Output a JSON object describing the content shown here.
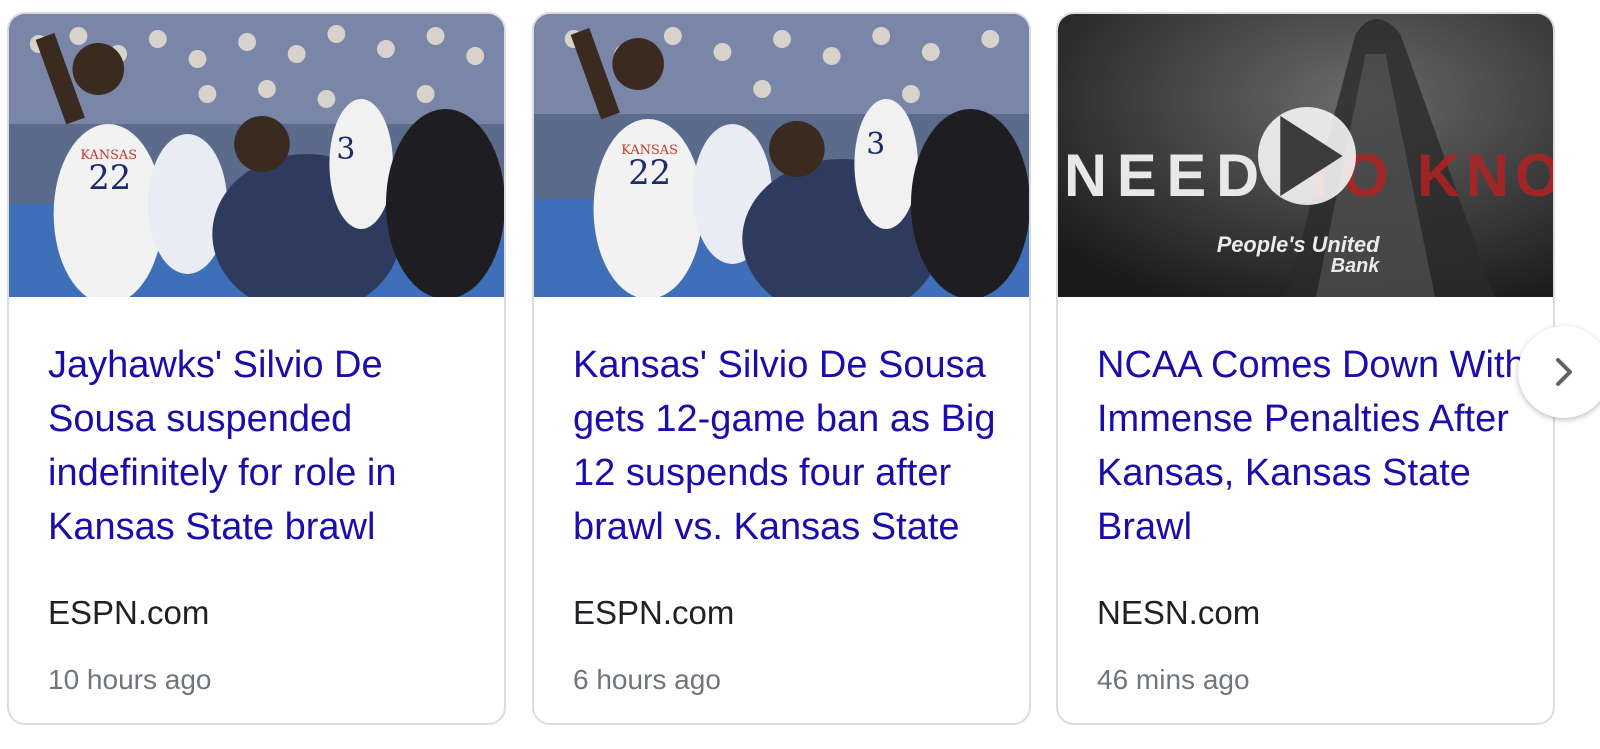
{
  "cards": [
    {
      "title": "Jayhawks' Silvio De Sousa suspended indefinitely for role in Kansas State brawl",
      "source": "ESPN.com",
      "time": "10 hours ago",
      "jersey_numbers": [
        "22",
        "3"
      ],
      "jersey_text": "KANSAS"
    },
    {
      "title": "Kansas' Silvio De Sousa gets 12-game ban as Big 12 suspends four after brawl vs. Kansas State",
      "source": "ESPN.com",
      "time": "6 hours ago",
      "jersey_numbers": [
        "22",
        "3"
      ],
      "jersey_text": "KANSAS"
    },
    {
      "title": "NCAA Comes Down With Immense Penalties After Kansas, Kansas State Brawl",
      "source": "NESN.com",
      "time": "46 mins ago",
      "video_text_left": "NEED",
      "video_text_right": "TO KNOW",
      "sponsor_line1": "People's United",
      "sponsor_line2": "Bank"
    }
  ],
  "icons": {
    "play": "play-icon",
    "next": "chevron-right-icon"
  },
  "colors": {
    "title_link": "#1a0dab",
    "source_text": "#202124",
    "time_text": "#70757a",
    "card_border": "#dadce0"
  }
}
